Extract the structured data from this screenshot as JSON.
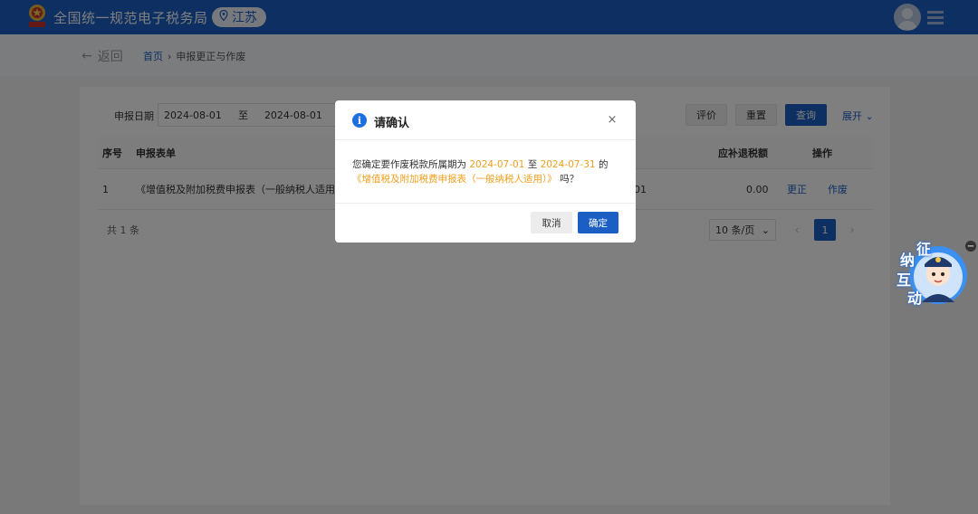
{
  "header": {
    "title": "全国统一规范电子税务局",
    "region": "江苏",
    "icons": {
      "emblem": "tax-emblem-icon",
      "location": "location-pin-icon",
      "avatar": "user-avatar-icon",
      "menu": "menu-icon"
    }
  },
  "breadcrumb": {
    "back_label": "返回",
    "home": "首页",
    "separator": "›",
    "current": "申报更正与作废"
  },
  "filters": {
    "date_label": "申报日期",
    "date_start": "2024-08-01",
    "date_sep": "至",
    "date_end": "2024-08-01",
    "buttons": {
      "evaluate": "评价",
      "reset": "重置",
      "query": "查询",
      "expand": "展开"
    }
  },
  "table": {
    "headers": {
      "index": "序号",
      "form": "申报表单",
      "amount": "应补退税额",
      "action": "操作"
    },
    "rows": [
      {
        "index": "1",
        "form": "《增值税及附加税费申报表（一般纳税人适用）》",
        "partial": "01",
        "amount": "0.00",
        "correct": "更正",
        "void": "作废"
      }
    ]
  },
  "pagination": {
    "total": "共 1 条",
    "page_size": "10 条/页",
    "prev": "‹",
    "next": "›",
    "current": "1"
  },
  "dialog": {
    "title": "请确认",
    "close": "×",
    "message_prefix": "您确定要作废税款所属期为",
    "date_from": "2024-07-01",
    "date_mid": "至",
    "date_to": "2024-07-31",
    "message_suffix": "的",
    "form_name": "《增值税及附加税费申报表（一般纳税人适用）》",
    "question": "吗？",
    "cancel": "取消",
    "confirm": "确定"
  },
  "mascot": {
    "chars": [
      "征",
      "纳",
      "互",
      "动"
    ],
    "minimize": "−"
  },
  "colors": {
    "brand": "#1b5fc4",
    "highlight": "#f0a020"
  }
}
